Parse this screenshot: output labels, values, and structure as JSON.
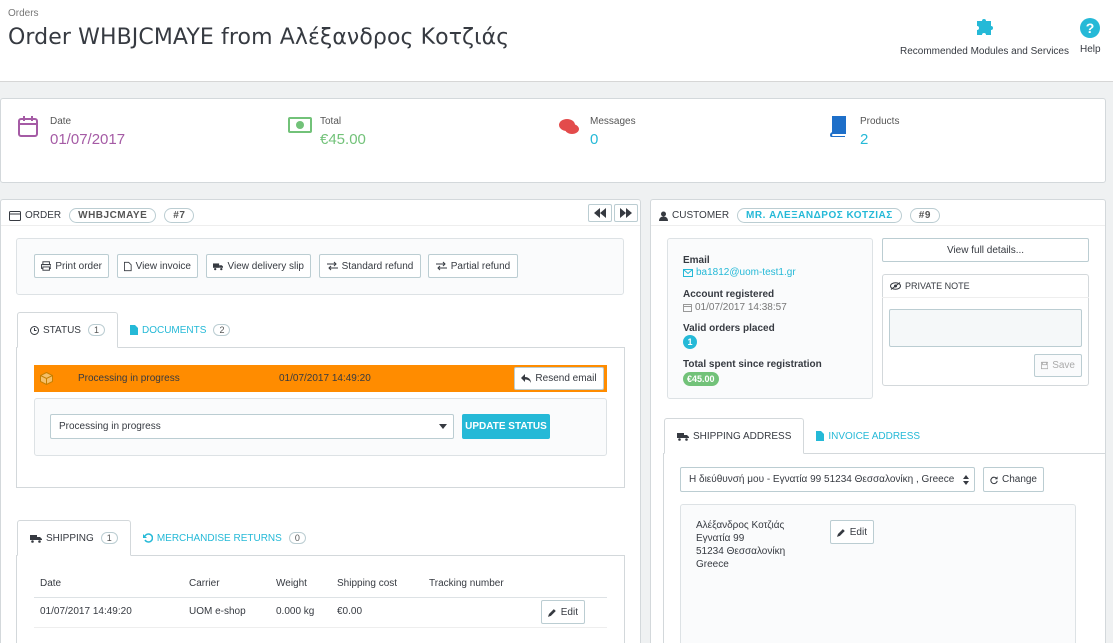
{
  "header": {
    "breadcrumb": "Orders",
    "title": "Order WHBJCMAYE from Αλέξανδρος Κοτζιάς",
    "recommended_label": "Recommended Modules and Services",
    "help_label": "Help"
  },
  "kpis": [
    {
      "label": "Date",
      "value": "01/07/2017",
      "color": "#a55ba5",
      "icon": "calendar-icon"
    },
    {
      "label": "Total",
      "value": "€45.00",
      "color": "#72c279",
      "icon": "money-icon"
    },
    {
      "label": "Messages",
      "value": "0",
      "color": "#25b9d7",
      "icon": "comments-icon"
    },
    {
      "label": "Products",
      "value": "2",
      "color": "#25b9d7",
      "icon": "book-icon"
    }
  ],
  "order": {
    "title": "Order",
    "reference": "WHBJCMAYE",
    "id": "#7",
    "actions": [
      "Print order",
      "View invoice",
      "View delivery slip",
      "Standard refund",
      "Partial refund"
    ],
    "tabs": [
      {
        "label": "Status",
        "count": "1"
      },
      {
        "label": "Documents",
        "count": "2"
      }
    ],
    "status_history": {
      "status": "Processing in progress",
      "date": "01/07/2017 14:49:20",
      "resend_label": "Resend email",
      "color": "#ff8c00"
    },
    "status_select": "Processing in progress",
    "update_label": "UPDATE STATUS",
    "shipping_tabs": [
      {
        "label": "Shipping",
        "count": "1"
      },
      {
        "label": "Merchandise Returns",
        "count": "0"
      }
    ],
    "shipping_table": {
      "headers": [
        "Date",
        "Carrier",
        "Weight",
        "Shipping cost",
        "Tracking number"
      ],
      "rows": [
        {
          "date": "01/07/2017 14:49:20",
          "carrier": "UOM e-shop",
          "weight": "0.000 kg",
          "cost": "€0.00",
          "tracking": ""
        }
      ],
      "edit_label": "Edit"
    }
  },
  "customer": {
    "title": "Customer",
    "name": "MR. ΑΛΕΞΑΝΔΡΟΣ ΚΟΤΖΙΑΣ",
    "id": "#9",
    "email_label": "Email",
    "email": "ba1812@uom-test1.gr",
    "registered_label": "Account registered",
    "registered": "01/07/2017 14:38:57",
    "orders_label": "Valid orders placed",
    "orders": "1",
    "spent_label": "Total spent since registration",
    "spent": "€45.00",
    "view_details_label": "View full details...",
    "private_note_label": "Private note",
    "save_label": "Save",
    "address_tabs": [
      "Shipping address",
      "Invoice address"
    ],
    "address_select": "Η διεύθυνσή μου - Εγνατία 99 51234 Θεσσαλονίκη , Greece",
    "change_label": "Change",
    "address_lines": [
      "Αλέξανδρος Κοτζιάς",
      "Εγνατία 99",
      "51234 Θεσσαλονίκη",
      "Greece"
    ],
    "edit_label": "Edit"
  }
}
